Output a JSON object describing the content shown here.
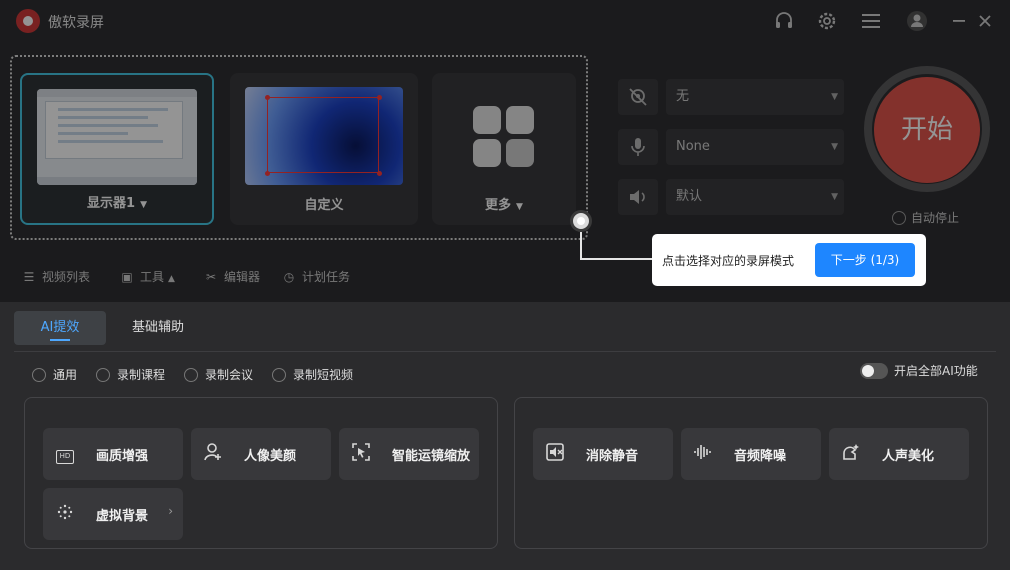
{
  "app": {
    "title": "傲软录屏"
  },
  "title_bar_icons": [
    "headset-icon",
    "gear-icon",
    "menu-icon",
    "avatar-icon",
    "minimize-icon",
    "close-icon"
  ],
  "sources": {
    "cards": [
      {
        "label": "显示器1",
        "has_dropdown": true,
        "selected": true
      },
      {
        "label": "自定义",
        "has_dropdown": false,
        "selected": false
      },
      {
        "label": "更多",
        "has_dropdown": true,
        "selected": false
      }
    ]
  },
  "inputs": {
    "camera": {
      "value": "无",
      "icon": "camera-off-icon"
    },
    "microphone": {
      "value": "None",
      "icon": "microphone-icon"
    },
    "speaker": {
      "value": "默认",
      "icon": "speaker-icon"
    }
  },
  "start": {
    "label": "开始",
    "auto_stop_label": "自动停止"
  },
  "toolbar": {
    "video_list": "视频列表",
    "tools": "工具",
    "editor": "编辑器",
    "scheduled": "计划任务"
  },
  "guide": {
    "text": "点击选择对应的录屏模式",
    "next_button": "下一步 (1/3)"
  },
  "tabs": [
    {
      "label": "AI提效",
      "active": true
    },
    {
      "label": "基础辅助",
      "active": false
    }
  ],
  "modes": [
    "通用",
    "录制课程",
    "录制会议",
    "录制短视频"
  ],
  "all_ai": {
    "label": "开启全部AI功能",
    "enabled": false
  },
  "features_left": [
    {
      "label": "画质增强",
      "icon": "hd-icon"
    },
    {
      "label": "人像美颜",
      "icon": "portrait-icon"
    },
    {
      "label": "智能运镜缩放",
      "icon": "cursor-focus-icon"
    },
    {
      "label": "虚拟背景",
      "icon": "sparkle-icon",
      "has_chevron": true
    }
  ],
  "features_right": [
    {
      "label": "消除静音",
      "icon": "mute-remove-icon"
    },
    {
      "label": "音频降噪",
      "icon": "waveform-icon"
    },
    {
      "label": "人声美化",
      "icon": "voice-beautify-icon"
    }
  ],
  "colors": {
    "accent": "#1e86ff",
    "selected_border": "#46c9e6",
    "start": "#e2554d"
  }
}
